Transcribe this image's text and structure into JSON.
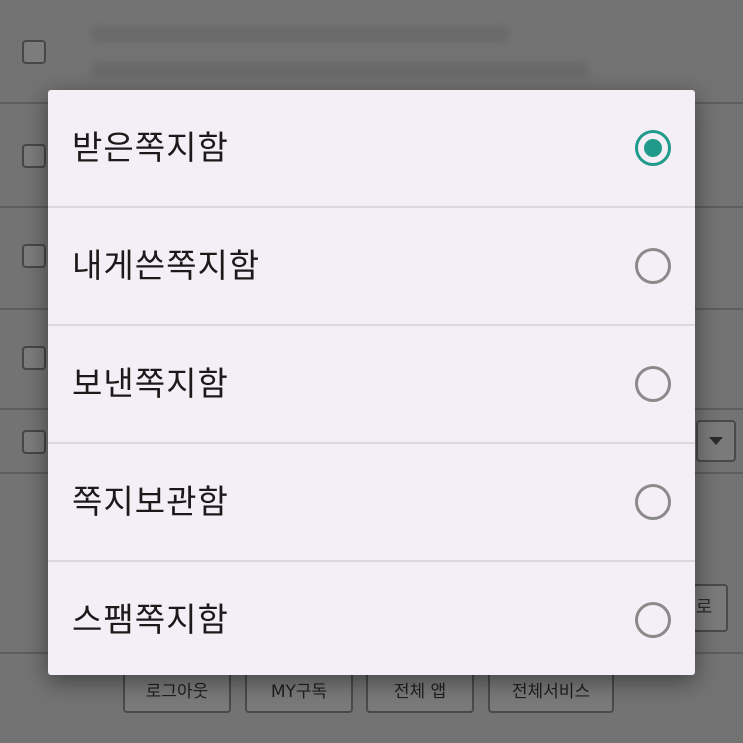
{
  "dialog": {
    "options": [
      {
        "label": "받은쪽지함",
        "selected": true
      },
      {
        "label": "내게쓴쪽지함",
        "selected": false
      },
      {
        "label": "보낸쪽지함",
        "selected": false
      },
      {
        "label": "쪽지보관함",
        "selected": false
      },
      {
        "label": "스팸쪽지함",
        "selected": false
      }
    ],
    "accent_color": "#1f9a8b"
  },
  "background": {
    "close_button_partial": "로",
    "footer_buttons": [
      "로그아웃",
      "MY구독",
      "전체 앱",
      "전체서비스"
    ]
  }
}
